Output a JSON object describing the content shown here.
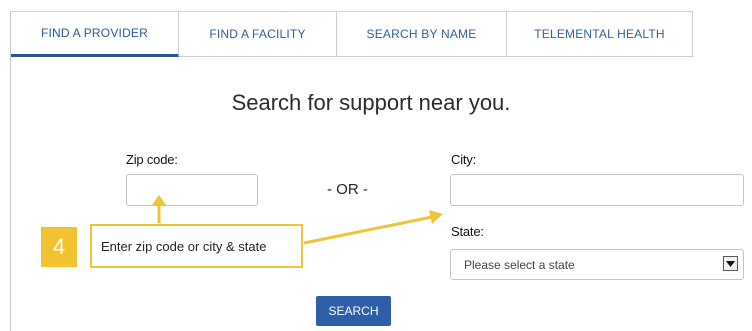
{
  "tabs": [
    {
      "label": "FIND A PROVIDER",
      "active": true
    },
    {
      "label": "FIND A FACILITY",
      "active": false
    },
    {
      "label": "SEARCH BY NAME",
      "active": false
    },
    {
      "label": "TELEMENTAL HEALTH",
      "active": false
    }
  ],
  "heading": "Search for support near you.",
  "zip": {
    "label": "Zip code:",
    "value": "",
    "placeholder": ""
  },
  "or_text": "- OR -",
  "city": {
    "label": "City:",
    "value": "",
    "placeholder": ""
  },
  "state": {
    "label": "State:",
    "selected": "Please select a state"
  },
  "search_button": "SEARCH",
  "callout": {
    "step": "4",
    "text": "Enter zip code or city & state"
  },
  "colors": {
    "accent": "#2e5ea8",
    "callout": "#f2c230"
  }
}
